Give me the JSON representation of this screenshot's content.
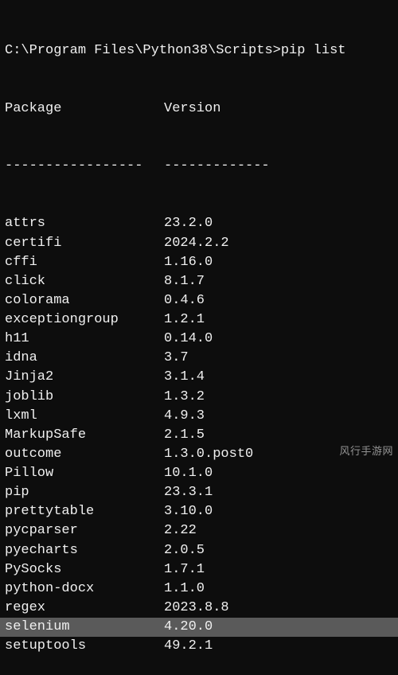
{
  "prompt": {
    "path": "C:\\Program Files\\Python38\\Scripts>",
    "command": "pip list"
  },
  "headers": {
    "package": "Package",
    "version": "Version"
  },
  "divider": {
    "package": "-----------------",
    "version": "-------------"
  },
  "packages": [
    {
      "name": "attrs",
      "version": "23.2.0",
      "highlight": false
    },
    {
      "name": "certifi",
      "version": "2024.2.2",
      "highlight": false
    },
    {
      "name": "cffi",
      "version": "1.16.0",
      "highlight": false
    },
    {
      "name": "click",
      "version": "8.1.7",
      "highlight": false
    },
    {
      "name": "colorama",
      "version": "0.4.6",
      "highlight": false
    },
    {
      "name": "exceptiongroup",
      "version": "1.2.1",
      "highlight": false
    },
    {
      "name": "h11",
      "version": "0.14.0",
      "highlight": false
    },
    {
      "name": "idna",
      "version": "3.7",
      "highlight": false
    },
    {
      "name": "Jinja2",
      "version": "3.1.4",
      "highlight": false
    },
    {
      "name": "joblib",
      "version": "1.3.2",
      "highlight": false
    },
    {
      "name": "lxml",
      "version": "4.9.3",
      "highlight": false
    },
    {
      "name": "MarkupSafe",
      "version": "2.1.5",
      "highlight": false
    },
    {
      "name": "outcome",
      "version": "1.3.0.post0",
      "highlight": false
    },
    {
      "name": "Pillow",
      "version": "10.1.0",
      "highlight": false
    },
    {
      "name": "pip",
      "version": "23.3.1",
      "highlight": false
    },
    {
      "name": "prettytable",
      "version": "3.10.0",
      "highlight": false
    },
    {
      "name": "pycparser",
      "version": "2.22",
      "highlight": false
    },
    {
      "name": "pyecharts",
      "version": "2.0.5",
      "highlight": false
    },
    {
      "name": "PySocks",
      "version": "1.7.1",
      "highlight": false
    },
    {
      "name": "python-docx",
      "version": "1.1.0",
      "highlight": false
    },
    {
      "name": "regex",
      "version": "2023.8.8",
      "highlight": false
    },
    {
      "name": "selenium",
      "version": "4.20.0",
      "highlight": true
    },
    {
      "name": "setuptools",
      "version": "49.2.1",
      "highlight": false
    }
  ],
  "watermark": "风行手游网"
}
